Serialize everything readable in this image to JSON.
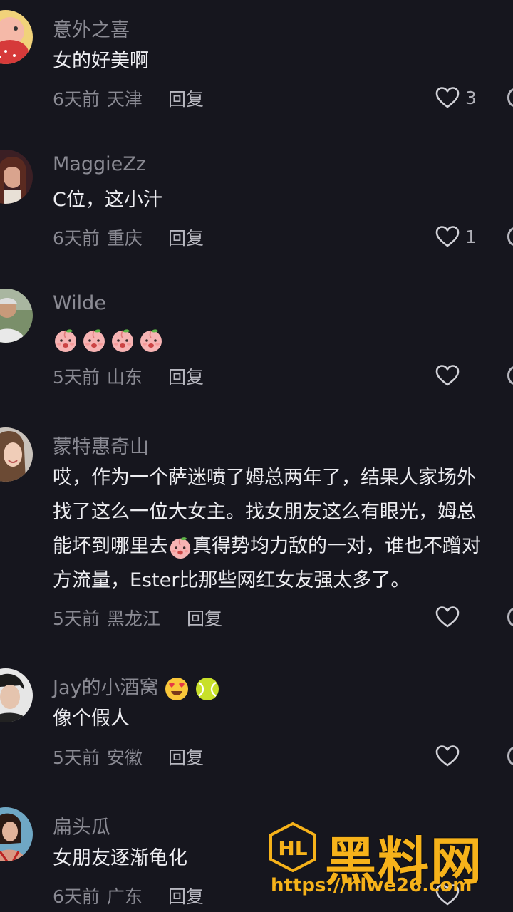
{
  "comments": [
    {
      "username": "意外之喜",
      "text": "女的好美啊",
      "time": "6天前",
      "location": "天津",
      "reply_label": "回复",
      "likes": "3"
    },
    {
      "username": "MaggieZz",
      "text": "C位，这小汁",
      "time": "6天前",
      "location": "重庆",
      "reply_label": "回复",
      "likes": "1"
    },
    {
      "username": "Wilde",
      "text": "",
      "time": "5天前",
      "location": "山东",
      "reply_label": "回复",
      "likes": ""
    },
    {
      "username": "蒙特惠奇山",
      "text_lines": [
        "哎，作为一个萨迷喷了姆总两年了，结果人家场外",
        "找了这么一位大女主。找女朋友这么有眼光，姆总",
        "能坏到哪里去",
        "真得势均力敌的一对，谁也不蹭对",
        "方流量，Ester比那些网红女友强太多了。"
      ],
      "time": "5天前",
      "location": "黑龙江",
      "reply_label": "回复",
      "likes": ""
    },
    {
      "username": "Jay的小酒窝",
      "text": "像个假人",
      "time": "5天前",
      "location": "安徽",
      "reply_label": "回复",
      "likes": ""
    },
    {
      "username": "扁头瓜",
      "text": "女朋友逐渐龟化",
      "time": "6天前",
      "location": "广东",
      "reply_label": "回复",
      "likes": ""
    }
  ],
  "icons": {
    "like": "heart-outline-icon",
    "peach": "peach-emoji",
    "heart_eyes": "heart-eyes-emoji",
    "tennis": "tennis-ball-emoji"
  },
  "watermark": {
    "title": "黑料网",
    "url": "https://hlwe26.com",
    "logo_letters": "HL"
  },
  "colors": {
    "background": "#16161e",
    "username": "#8a8a93",
    "text": "#ececf0",
    "watermark": "#f6b21a"
  }
}
